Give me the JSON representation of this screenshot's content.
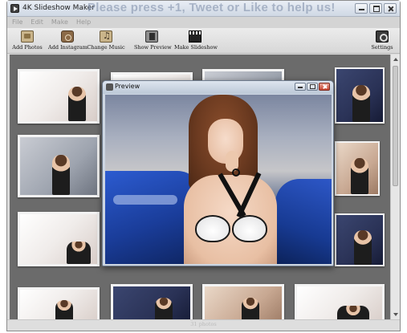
{
  "window": {
    "title": "4K Slideshow Maker",
    "promo": "Please press +1, Tweet or Like to help us!"
  },
  "menu": [
    "File",
    "Edit",
    "Make",
    "Help"
  ],
  "toolbar": {
    "add_photos": "Add Photos",
    "add_instagram": "Add Instagram",
    "change_music": "Change Music",
    "show_preview": "Show Preview",
    "make_slideshow": "Make Slideshow",
    "settings": "Settings"
  },
  "icons": {
    "add_photos": "photo-stack-icon",
    "add_instagram": "instagram-icon",
    "change_music": "music-note-icon",
    "show_preview": "preview-player-icon",
    "make_slideshow": "clapperboard-icon",
    "settings": "settings-gear-icon"
  },
  "preview": {
    "title": "Preview"
  },
  "status": {
    "photo_count": "31 photos"
  },
  "colors": {
    "content_bg": "#6b6b6b",
    "toolbar_bg": "#dcdcdc"
  }
}
